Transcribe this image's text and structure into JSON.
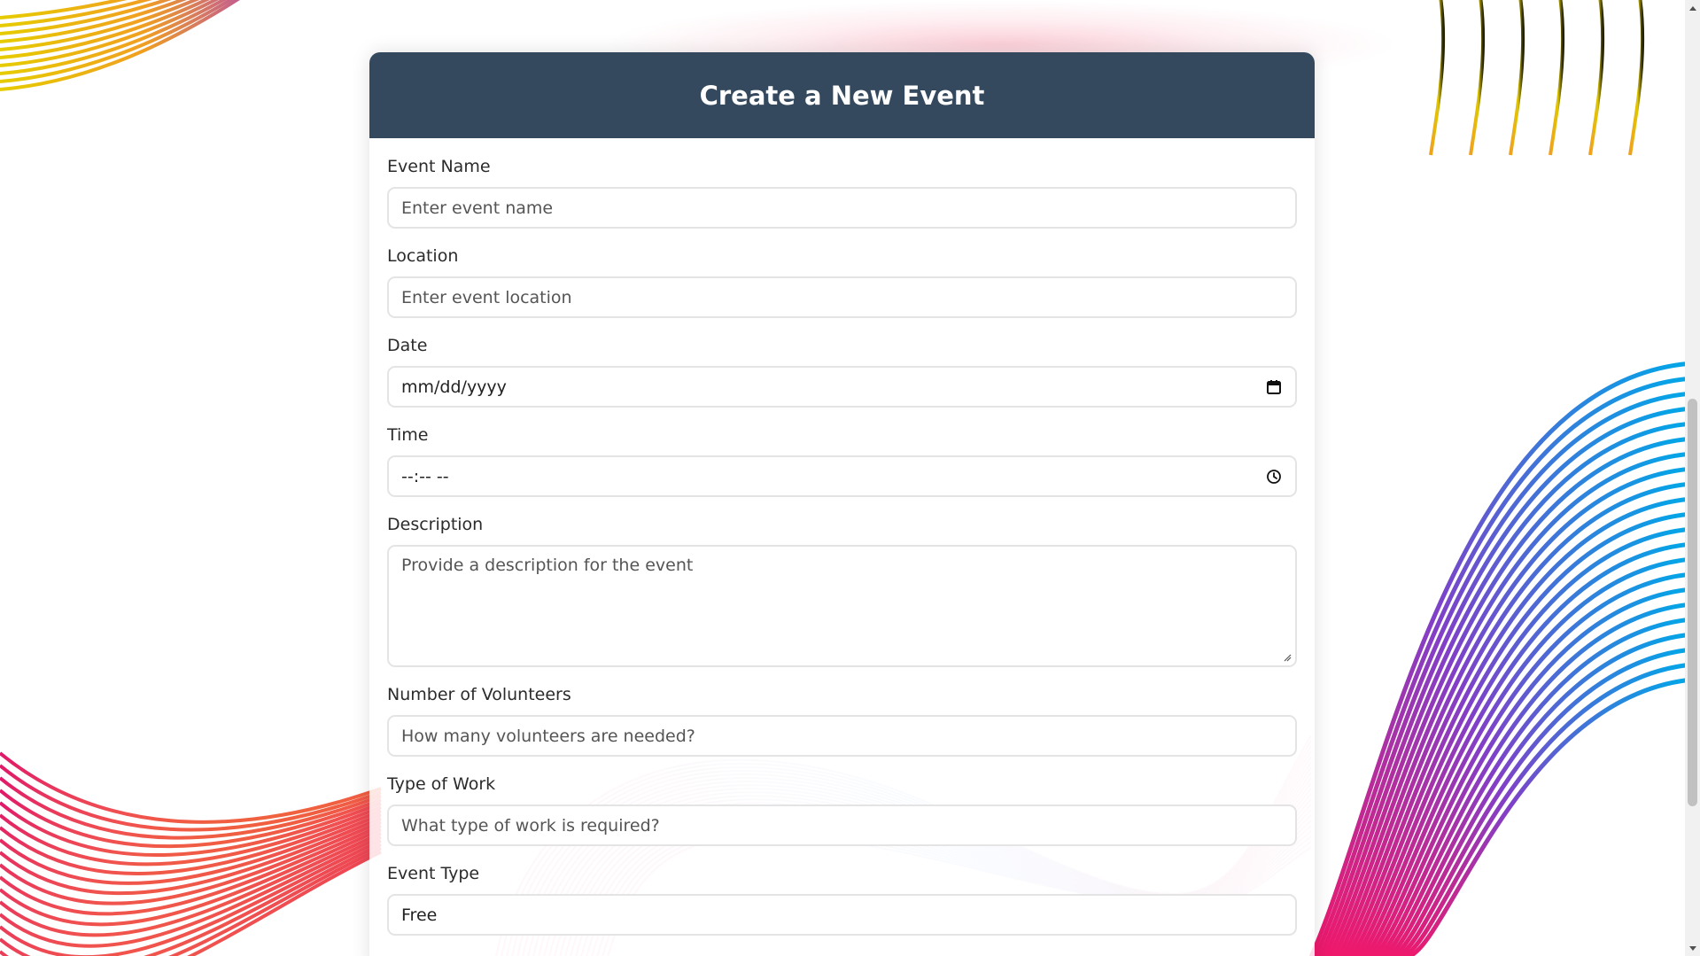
{
  "form": {
    "title": "Create a New Event",
    "fields": {
      "event_name": {
        "label": "Event Name",
        "placeholder": "Enter event name"
      },
      "location": {
        "label": "Location",
        "placeholder": "Enter event location"
      },
      "date": {
        "label": "Date",
        "value": "mm/dd/yyyy"
      },
      "time": {
        "label": "Time",
        "value": "--:-- --"
      },
      "description": {
        "label": "Description",
        "placeholder": "Provide a description for the event"
      },
      "volunteers": {
        "label": "Number of Volunteers",
        "placeholder": "How many volunteers are needed?"
      },
      "work_type": {
        "label": "Type of Work",
        "placeholder": "What type of work is required?"
      },
      "event_type": {
        "label": "Event Type",
        "value": "Free"
      }
    }
  },
  "icons": {
    "date": "calendar-icon",
    "time": "clock-icon"
  },
  "colors": {
    "header_bg": "#34495e",
    "header_text": "#ffffff",
    "input_border": "#e4e4e4"
  }
}
